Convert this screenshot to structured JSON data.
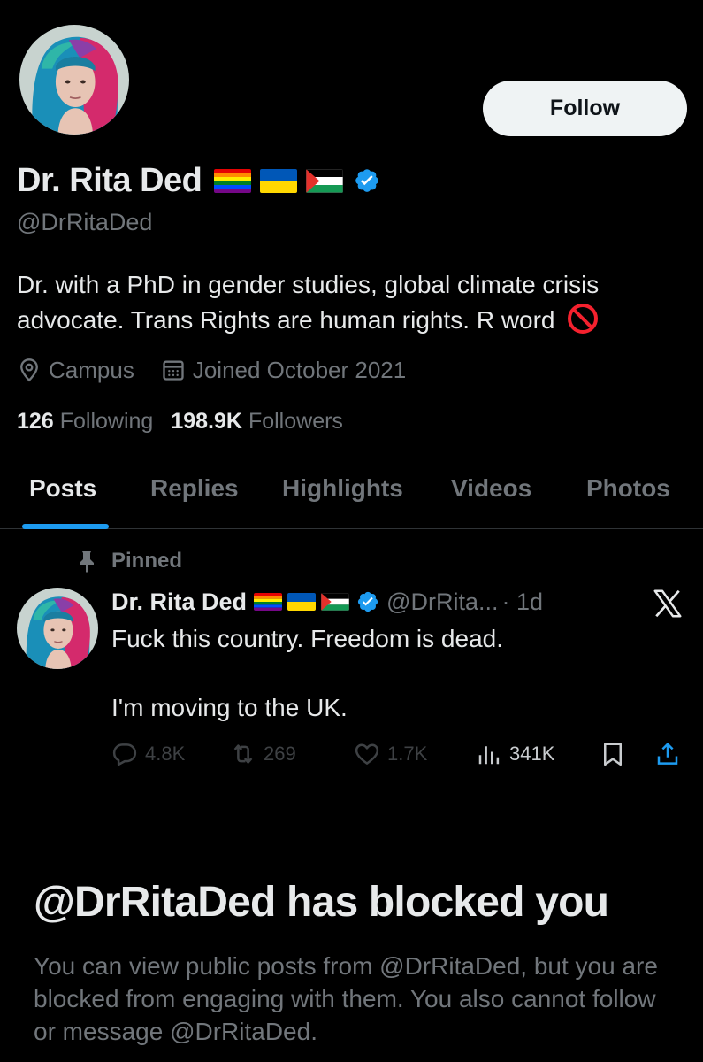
{
  "profile": {
    "display_name": "Dr. Rita Ded",
    "handle": "@DrRitaDed",
    "follow_label": "Follow",
    "flags": [
      "rainbow-flag-icon",
      "ukraine-flag-icon",
      "palestine-flag-icon"
    ],
    "verified": true,
    "bio": "Dr. with a PhD in gender studies, global climate crisis advocate. Trans Rights are human rights. R word",
    "location": "Campus",
    "joined": "Joined October 2021",
    "following_count": "126",
    "following_label": "Following",
    "followers_count": "198.9K",
    "followers_label": "Followers"
  },
  "tabs": [
    {
      "label": "Posts",
      "active": true
    },
    {
      "label": "Replies",
      "active": false
    },
    {
      "label": "Highlights",
      "active": false
    },
    {
      "label": "Videos",
      "active": false
    },
    {
      "label": "Photos",
      "active": false
    }
  ],
  "pinned_post": {
    "pinned_label": "Pinned",
    "author_name": "Dr. Rita Ded",
    "author_handle": "@DrRita...",
    "time": "· 1d",
    "text_line1": "Fuck this country. Freedom is dead.",
    "text_line2": "I'm moving to the UK.",
    "replies": "4.8K",
    "reposts": "269",
    "likes": "1.7K",
    "views": "341K"
  },
  "blocked": {
    "title": "@DrRitaDed has blocked you",
    "description": "You can view public posts from @DrRitaDed, but you are blocked from engaging with them. You also cannot follow or message @DrRitaDed."
  },
  "colors": {
    "background": "#000000",
    "primary_text": "#e7e9ea",
    "secondary_text": "#71767b",
    "accent_blue": "#1d9bf0",
    "follow_bg": "#eff3f4"
  }
}
